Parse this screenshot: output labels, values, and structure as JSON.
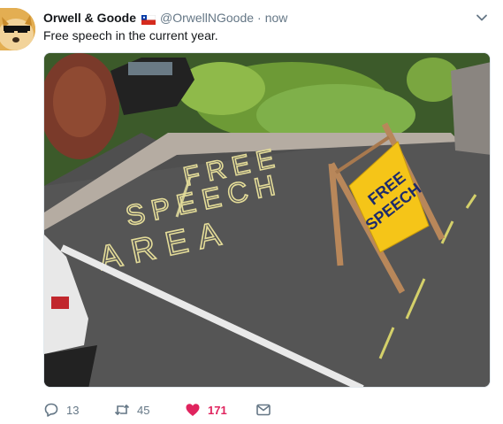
{
  "tweet": {
    "display_name": "Orwell & Goode",
    "handle": "@OrwellNGoode",
    "separator": "·",
    "time": "now",
    "text": "Free speech in the current year.",
    "image": {
      "ground_text": [
        "FREE",
        "SPEECH",
        "AREA"
      ],
      "sign_text": [
        "FREE",
        "SPEECH"
      ]
    },
    "actions": {
      "reply_count": "13",
      "retweet_count": "45",
      "like_count": "171"
    }
  },
  "colors": {
    "like_active": "#e0245e",
    "muted": "#657786",
    "text": "#14171a",
    "sign_yellow": "#f5c518"
  },
  "icons": {
    "avatar": "doge-with-sunglasses",
    "flag": "chile-flag-icon",
    "caret": "chevron-down-icon",
    "reply": "reply-icon",
    "retweet": "retweet-icon",
    "like": "heart-icon",
    "dm": "envelope-icon"
  }
}
